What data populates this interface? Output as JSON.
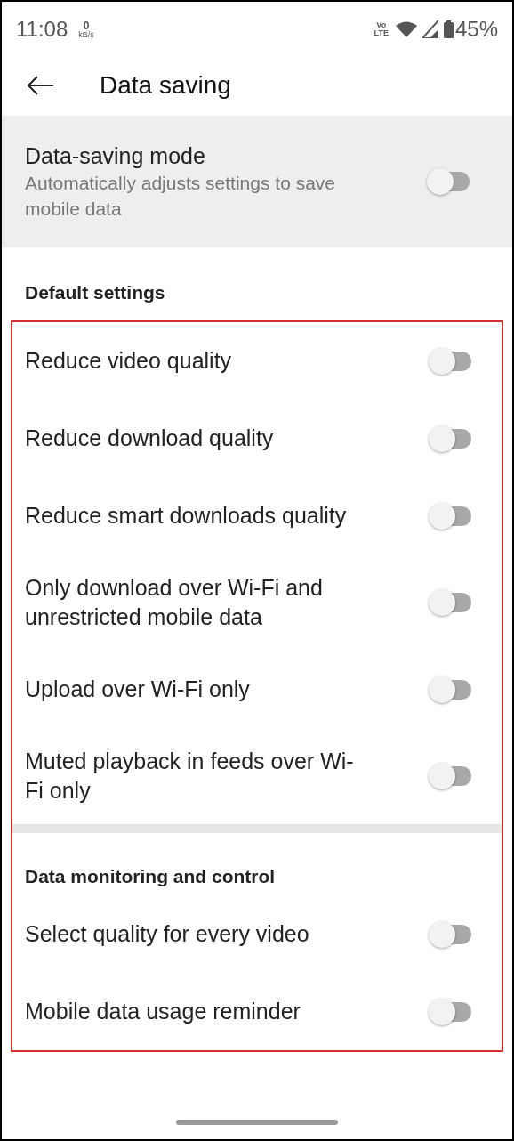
{
  "status_bar": {
    "time": "11:08",
    "net_speed": "0",
    "net_speed_unit": "kB/s",
    "volte_top": "Vo",
    "volte_bottom": "LTE",
    "battery": "45%"
  },
  "header": {
    "title": "Data saving"
  },
  "data_saving_mode": {
    "title": "Data-saving mode",
    "subtitle": "Automatically adjusts settings to save mobile data",
    "on": false
  },
  "sections": [
    {
      "heading": "Default settings",
      "items": [
        {
          "label": "Reduce video quality",
          "on": false
        },
        {
          "label": "Reduce download quality",
          "on": false
        },
        {
          "label": "Reduce smart downloads quality",
          "on": false
        },
        {
          "label": "Only download over Wi-Fi and unrestricted mobile data",
          "on": false
        },
        {
          "label": "Upload over Wi-Fi only",
          "on": false
        },
        {
          "label": "Muted playback in feeds over Wi-Fi only",
          "on": false
        }
      ]
    },
    {
      "heading": "Data monitoring and control",
      "items": [
        {
          "label": "Select quality for every video",
          "on": false
        },
        {
          "label": "Mobile data usage reminder",
          "on": false
        }
      ]
    }
  ]
}
